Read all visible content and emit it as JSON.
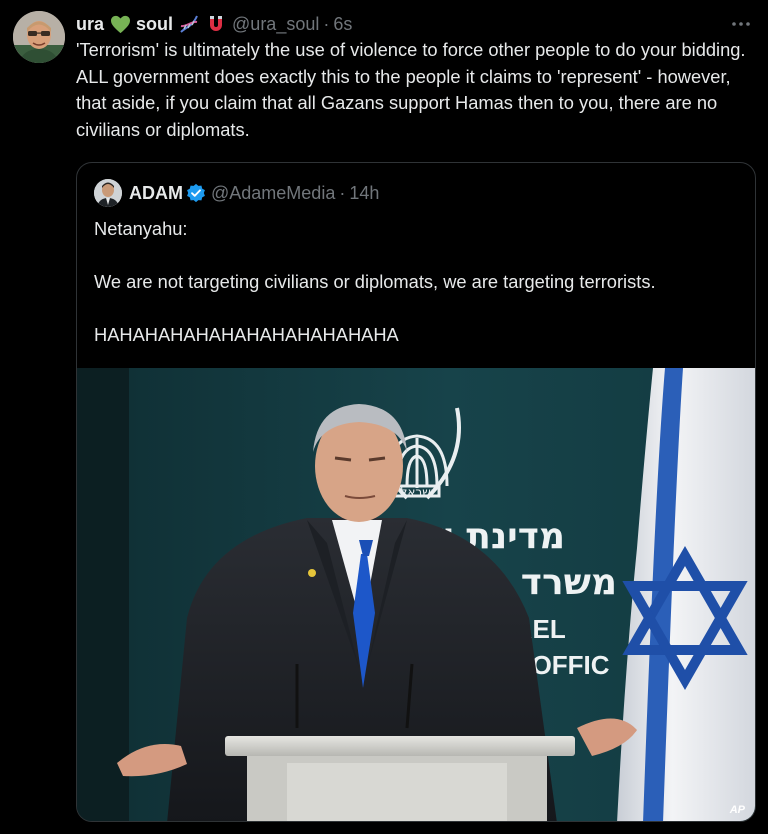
{
  "post": {
    "display_name": "ura",
    "display_name_suffix": "soul",
    "handle": "@ura_soul",
    "separator": "·",
    "time": "6s",
    "more_label": "···",
    "text": "'Terrorism' is ultimately the use of violence to force other people to do your bidding. ALL government does exactly this to the people it claims to 'represent' - however, that aside, if you claim that all Gazans support Hamas then to you, there are no civilians or diplomats.",
    "emojis": [
      "green-heart-icon",
      "dna-icon",
      "magnet-icon"
    ]
  },
  "quote": {
    "display_name": "ADAM",
    "handle": "@AdameMedia",
    "separator": "·",
    "time": "14h",
    "lines": [
      "Netanyahu:",
      "",
      "We are not targeting civilians or diplomats, we are targeting terrorists.",
      "",
      "HAHAHAHAHAHAHAHAHAHAHAHA"
    ],
    "media": {
      "sign_hebrew_1": "מדינת ישראל",
      "sign_hebrew_2": "משרד ראש",
      "sign_english_1": "RAEL",
      "sign_english_2": "S OFFIC",
      "emblem_caption": "ישראל",
      "credit": "AP"
    }
  },
  "colors": {
    "background": "#000000",
    "text_primary": "#e7e9ea",
    "text_secondary": "#71767b",
    "border": "#2f3336",
    "verified_blue": "#1d9bf0",
    "backdrop_teal": "#143b40",
    "flag_blue": "#1f4fa8",
    "tie_blue": "#1d57c9"
  }
}
